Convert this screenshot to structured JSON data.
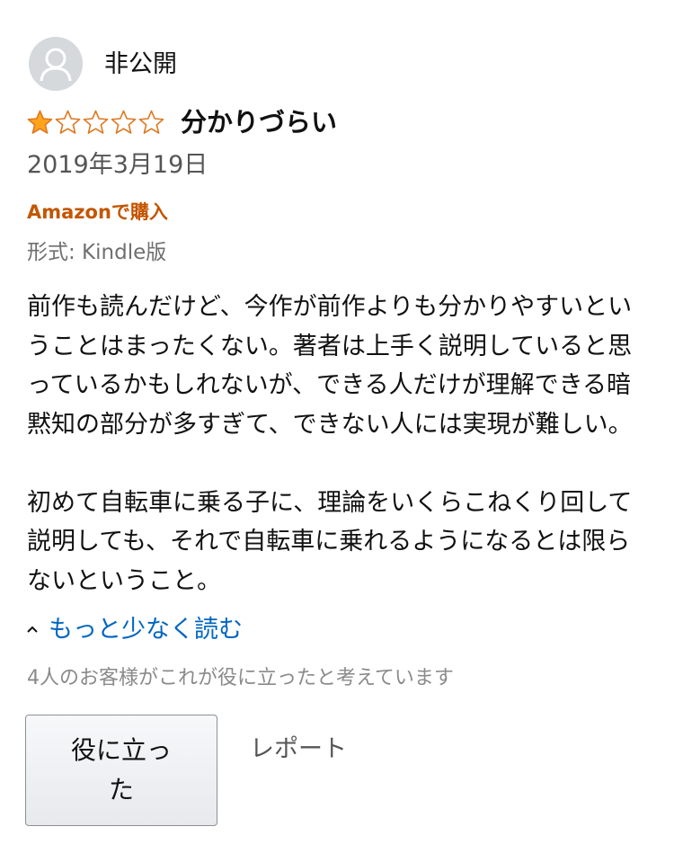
{
  "review": {
    "author": "非公開",
    "rating": 1,
    "rating_max": 5,
    "title": "分かりづらい",
    "date": "2019年3月19日",
    "purchase_badge": "Amazonで購入",
    "format": "形式: Kindle版",
    "body_paragraph_1": "前作も読んだけど、今作が前作よりも分かりやすいということはまったくない。著者は上手く説明していると思っているかもしれないが、できる人だけが理解できる暗黙知の部分が多すぎて、できない人には実現が難しい。",
    "body_paragraph_2": "初めて自転車に乗る子に、理論をいくらこねくり回して説明しても、それで自転車に乗れるようになるとは限らないということ。",
    "read_less_label": "もっと少なく読む",
    "helpful_count_text": "4人のお客様がこれが役に立ったと考えています",
    "helpful_button_label": "役に立った",
    "report_label": "レポート"
  },
  "colors": {
    "star_filled": "#ffa41c",
    "star_outline": "#de7921",
    "purchase_badge": "#c45500",
    "link": "#0066c0"
  },
  "icons": {
    "avatar": "person-silhouette-icon",
    "star_filled": "star-filled-icon",
    "star_empty": "star-outline-icon",
    "read_less": "chevron-up-icon"
  }
}
